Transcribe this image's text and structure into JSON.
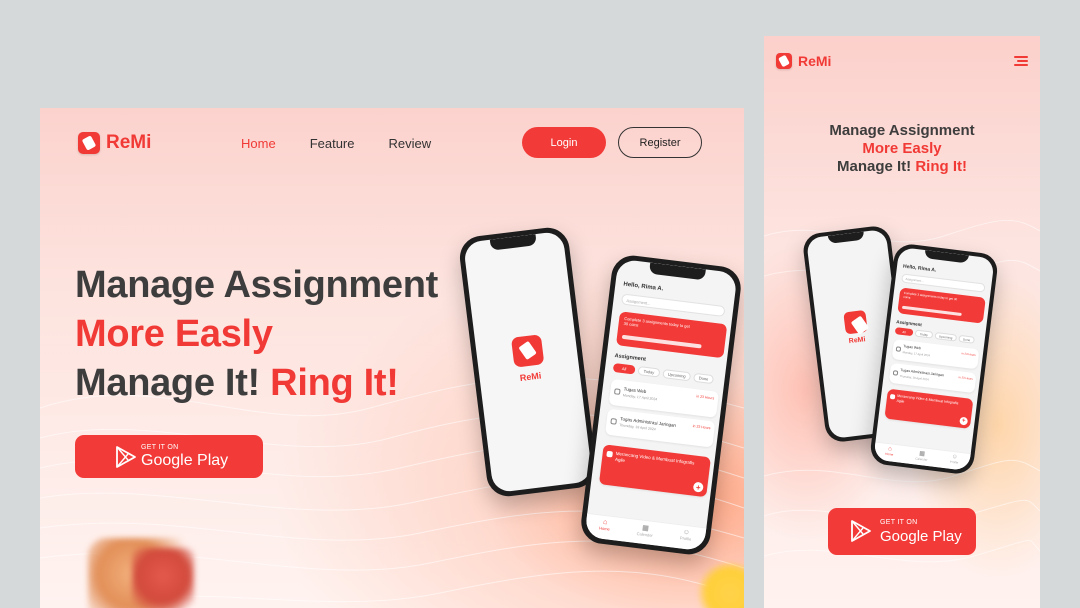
{
  "brand": {
    "name": "ReMi",
    "color": "#f13a36"
  },
  "nav": {
    "home": "Home",
    "feature": "Feature",
    "review": "Review"
  },
  "auth": {
    "login": "Login",
    "register": "Register"
  },
  "hero": {
    "line1": "Manage Assignment",
    "line2": "More Easly",
    "line3a": "Manage It!",
    "line3b": "Ring It!"
  },
  "store_button": {
    "small": "GET IT ON",
    "big": "Google Play"
  },
  "app_splash": {
    "label": "ReMi"
  },
  "app_home": {
    "greeting": "Hello, Rima A.",
    "search_placeholder": "Assignment...",
    "promo": "Complete 3 assignments today to get 30 coins",
    "section": "Assignment",
    "chips": [
      "All",
      "Today",
      "Upcoming",
      "Done"
    ],
    "cards": [
      {
        "title": "Tugas Web",
        "date": "Monday, 17 April 2024",
        "hours": "in 23 Hours"
      },
      {
        "title": "Tugas Administrasi Jaringan",
        "date": "Thursday, 18 April 2024",
        "hours": "in 23 Hours"
      },
      {
        "title": "Merancang Video & Membuat Infografis Agile"
      }
    ],
    "tabs": [
      "Home",
      "Calender",
      "Profile"
    ]
  },
  "mobile_hero": {
    "line1": "Manage Assignment",
    "line2": "More Easly",
    "line3a": "Manage It!",
    "line3b": "Ring It!"
  }
}
